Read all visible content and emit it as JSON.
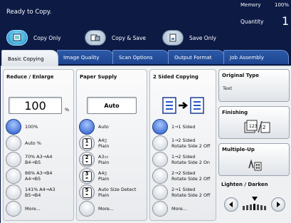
{
  "status": {
    "message": "Ready to Copy.",
    "memory_label": "Memory",
    "memory_value": "100%",
    "quantity_label": "Quantity",
    "quantity_value": "1"
  },
  "modes": [
    {
      "label": "Copy Only",
      "icon": "copy-icon",
      "active": true
    },
    {
      "label": "Copy & Save",
      "icon": "copy-save-icon",
      "active": false
    },
    {
      "label": "Save Only",
      "icon": "save-icon",
      "active": false
    }
  ],
  "tabs": [
    "Basic Copying",
    "Image Quality",
    "Scan Options",
    "Output Format",
    "Job Assembly"
  ],
  "reduce": {
    "title": "Reduce / Enlarge",
    "value": "100",
    "unit": "%",
    "options": [
      {
        "line1": "100%",
        "line2": ""
      },
      {
        "line1": "Auto %",
        "line2": ""
      },
      {
        "line1": "70% A3→A4",
        "line2": "B4→B5"
      },
      {
        "line1": "86% A3→B4",
        "line2": "A4→B5"
      },
      {
        "line1": "141% A4→A3",
        "line2": "B5→B4"
      },
      {
        "line1": "More...",
        "line2": ""
      }
    ]
  },
  "paper": {
    "title": "Paper Supply",
    "value": "Auto",
    "options": [
      {
        "line1": "Auto",
        "line2": "",
        "tray": ""
      },
      {
        "line1": "A4▯",
        "line2": "Plain",
        "tray": "1"
      },
      {
        "line1": "A3▭",
        "line2": "Plain",
        "tray": "2"
      },
      {
        "line1": "A4▯",
        "line2": "Plain",
        "tray": "3"
      },
      {
        "line1": "Auto Size Detect",
        "line2": "Plain",
        "tray": "5"
      },
      {
        "line1": "More...",
        "line2": "",
        "tray": ""
      }
    ]
  },
  "sided": {
    "title": "2 Sided Copying",
    "options": [
      {
        "line1": "1→1 Sided",
        "line2": ""
      },
      {
        "line1": "1→2 Sided",
        "line2": "Rotate Side 2 Off"
      },
      {
        "line1": "1→2 Sided",
        "line2": "Rotate Side 2 On"
      },
      {
        "line1": "2→2 Sided",
        "line2": "Rotate Side 2 Off"
      },
      {
        "line1": "2→1 Sided",
        "line2": "Rotate Side 2 Off"
      },
      {
        "line1": "More...",
        "line2": ""
      }
    ]
  },
  "original_type": {
    "title": "Original Type",
    "value": "Text"
  },
  "finishing": {
    "title": "Finishing"
  },
  "multiple_up": {
    "title": "Multiple-Up"
  },
  "lighten": {
    "title": "Lighten / Darken"
  },
  "colors": {
    "accent": "#1f8ac2",
    "tab_blue": "#2b59a8",
    "selected_radio": "#2557c4"
  }
}
